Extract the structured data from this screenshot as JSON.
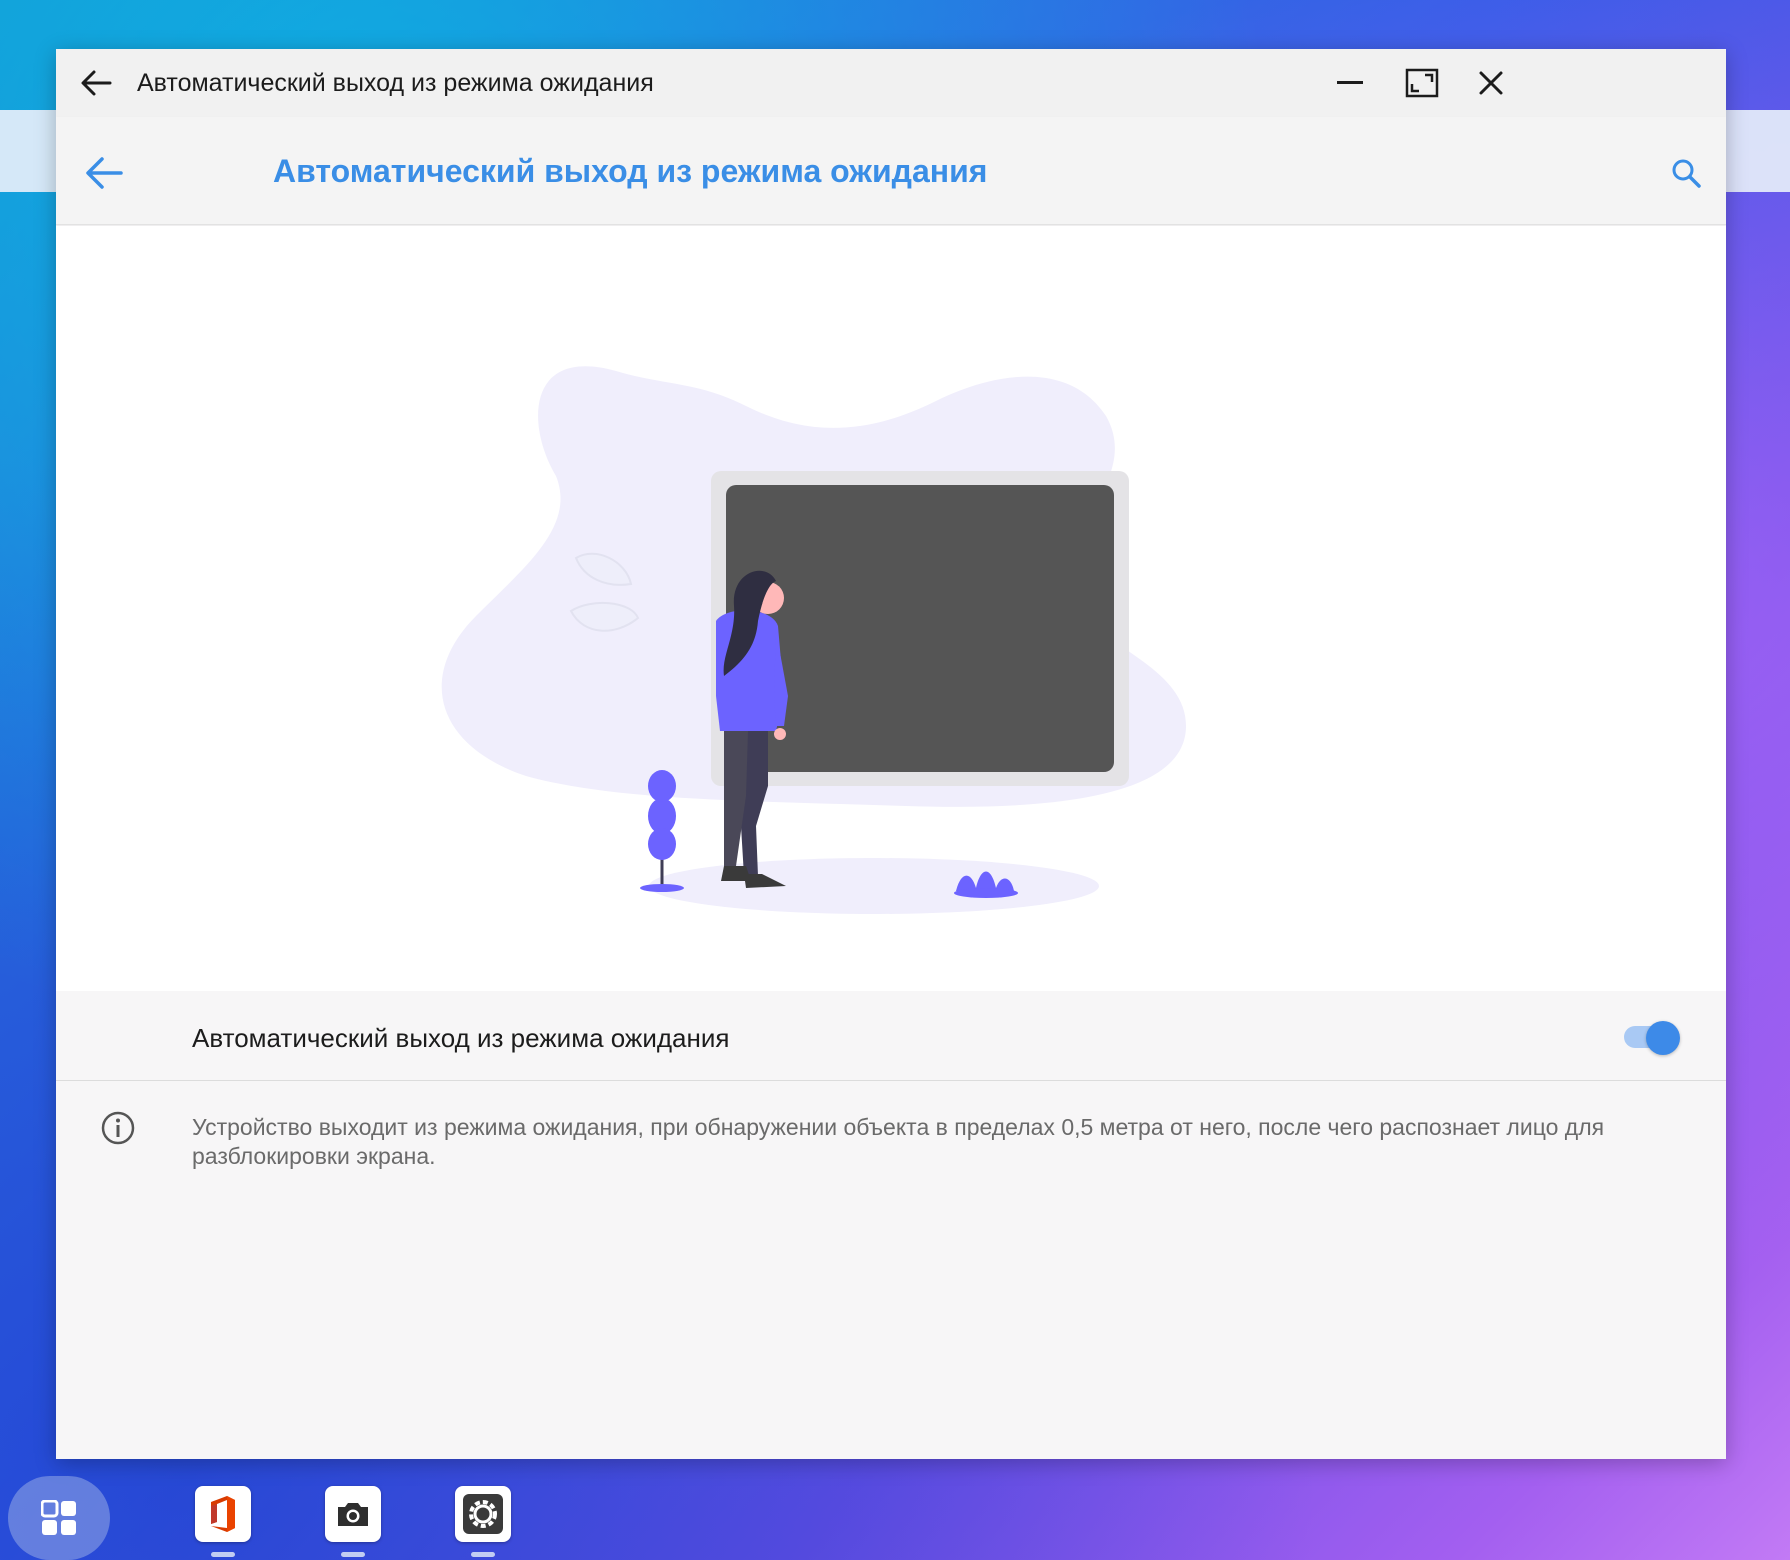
{
  "window": {
    "title": "Автоматический выход из режима ожидания",
    "controls": [
      "minimize-icon",
      "maximize-icon",
      "close-icon"
    ]
  },
  "appbar": {
    "title": "Автоматический выход из режима ожидания",
    "accent_color": "#3a8ee6"
  },
  "setting": {
    "label": "Автоматический выход из режима ожидания",
    "enabled": true,
    "switch_color": "#3d8ae8"
  },
  "info": {
    "text": "Устройство выходит из режима ожидания, при обнаружении объекта в пределах 0,5 метра от него, после чего распознает лицо для разблокировки экрана."
  },
  "taskbar": {
    "apps": [
      "start-menu-icon",
      "office-icon",
      "camera-icon",
      "settings-icon"
    ]
  }
}
